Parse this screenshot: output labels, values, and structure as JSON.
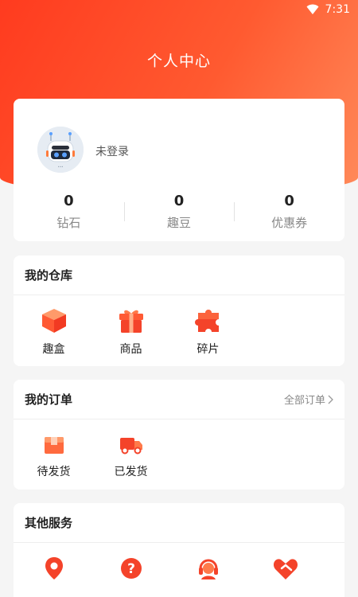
{
  "status_bar": {
    "time": "7:31"
  },
  "header": {
    "title": "个人中心"
  },
  "profile": {
    "login_text": "未登录",
    "stats": [
      {
        "value": "0",
        "label": "钻石"
      },
      {
        "value": "0",
        "label": "趣豆"
      },
      {
        "value": "0",
        "label": "优惠券"
      }
    ]
  },
  "warehouse": {
    "title": "我的仓库",
    "items": [
      {
        "label": "趣盒",
        "icon": "cube-box-icon"
      },
      {
        "label": "商品",
        "icon": "gift-icon"
      },
      {
        "label": "碎片",
        "icon": "puzzle-icon"
      }
    ]
  },
  "orders": {
    "title": "我的订单",
    "all_link": "全部订单",
    "items": [
      {
        "label": "待发货",
        "icon": "package-icon"
      },
      {
        "label": "已发货",
        "icon": "truck-icon"
      }
    ]
  },
  "services": {
    "title": "其他服务",
    "items": [
      {
        "label": "",
        "icon": "location-pin-icon"
      },
      {
        "label": "",
        "icon": "question-icon"
      },
      {
        "label": "",
        "icon": "customer-service-icon"
      },
      {
        "label": "",
        "icon": "handshake-heart-icon"
      }
    ]
  },
  "colors": {
    "accent": "#ff4a2a",
    "accent_light": "#ff8a5a"
  }
}
